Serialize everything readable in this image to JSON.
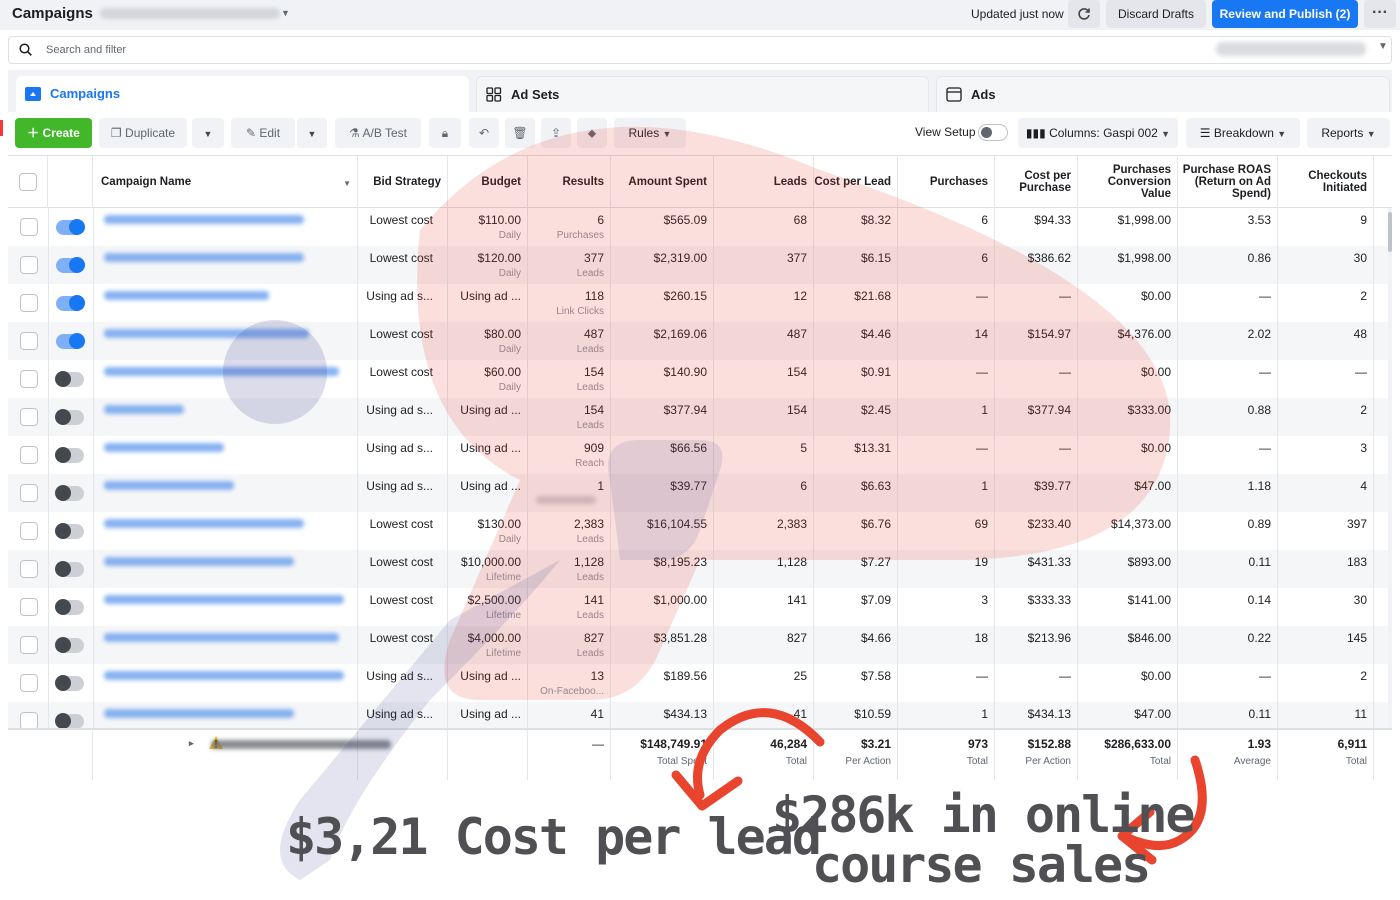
{
  "topbar": {
    "title": "Campaigns",
    "updated": "Updated just now",
    "discard": "Discard Drafts",
    "publish": "Review and Publish (2)",
    "more": "···"
  },
  "search": {
    "placeholder": "Search and filter"
  },
  "tabs": [
    {
      "label": "Campaigns",
      "icon": "folder-icon",
      "active": true
    },
    {
      "label": "Ad Sets",
      "icon": "grid-icon",
      "active": false
    },
    {
      "label": "Ads",
      "icon": "ad-icon",
      "active": false
    }
  ],
  "toolbar": {
    "create": "Create",
    "duplicate": "Duplicate",
    "edit": "Edit",
    "ab_test": "A/B Test",
    "rules": "Rules",
    "view_setup": "View Setup",
    "columns": "Columns: Gaspi 002",
    "breakdown": "Breakdown",
    "reports": "Reports"
  },
  "table": {
    "headers": {
      "campaign_name": "Campaign Name",
      "bid_strategy": "Bid Strategy",
      "budget": "Budget",
      "results": "Results",
      "amount_spent": "Amount Spent",
      "leads": "Leads",
      "cost_per_lead": "Cost per Lead",
      "purchases": "Purchases",
      "cost_per_purchase": "Cost per Purchase",
      "conversion_value": "Purchases Conversion Value",
      "roas": "Purchase ROAS (Return on Ad Spend)",
      "checkouts": "Checkouts Initiated"
    },
    "rows": [
      {
        "on": true,
        "bid": "Lowest cost",
        "budget": "$110.00",
        "budget_sub": "Daily",
        "results": "6",
        "results_sub": "Purchases",
        "spent": "$565.09",
        "leads": "68",
        "cpl": "$8.32",
        "purchases": "6",
        "cpp": "$94.33",
        "value": "$1,998.00",
        "roas": "3.53",
        "checkouts": "9"
      },
      {
        "on": true,
        "bid": "Lowest cost",
        "budget": "$120.00",
        "budget_sub": "Daily",
        "results": "377",
        "results_sub": "Leads",
        "spent": "$2,319.00",
        "leads": "377",
        "cpl": "$6.15",
        "purchases": "6",
        "cpp": "$386.62",
        "value": "$1,998.00",
        "roas": "0.86",
        "checkouts": "30"
      },
      {
        "on": true,
        "bid": "Using ad s...",
        "budget": "Using ad ...",
        "budget_sub": "",
        "results": "118",
        "results_sub": "Link Clicks",
        "spent": "$260.15",
        "leads": "12",
        "cpl": "$21.68",
        "purchases": "—",
        "cpp": "—",
        "value": "$0.00",
        "roas": "—",
        "checkouts": "2"
      },
      {
        "on": true,
        "bid": "Lowest cost",
        "budget": "$80.00",
        "budget_sub": "Daily",
        "results": "487",
        "results_sub": "Leads",
        "spent": "$2,169.06",
        "leads": "487",
        "cpl": "$4.46",
        "purchases": "14",
        "cpp": "$154.97",
        "value": "$4,376.00",
        "roas": "2.02",
        "checkouts": "48"
      },
      {
        "on": false,
        "bid": "Lowest cost",
        "budget": "$60.00",
        "budget_sub": "Daily",
        "results": "154",
        "results_sub": "Leads",
        "spent": "$140.90",
        "leads": "154",
        "cpl": "$0.91",
        "purchases": "—",
        "cpp": "—",
        "value": "$0.00",
        "roas": "—",
        "checkouts": "—"
      },
      {
        "on": false,
        "bid": "Using ad s...",
        "budget": "Using ad ...",
        "budget_sub": "",
        "results": "154",
        "results_sub": "Leads",
        "spent": "$377.94",
        "leads": "154",
        "cpl": "$2.45",
        "purchases": "1",
        "cpp": "$377.94",
        "value": "$333.00",
        "roas": "0.88",
        "checkouts": "2"
      },
      {
        "on": false,
        "bid": "Using ad s...",
        "budget": "Using ad ...",
        "budget_sub": "",
        "results": "909",
        "results_sub": "Reach",
        "spent": "$66.56",
        "leads": "5",
        "cpl": "$13.31",
        "purchases": "—",
        "cpp": "—",
        "value": "$0.00",
        "roas": "—",
        "checkouts": "3"
      },
      {
        "on": false,
        "bid": "Using ad s...",
        "budget": "Using ad ...",
        "budget_sub": "",
        "results": "1",
        "results_sub": "",
        "spent": "$39.77",
        "leads": "6",
        "cpl": "$6.63",
        "purchases": "1",
        "cpp": "$39.77",
        "value": "$47.00",
        "roas": "1.18",
        "checkouts": "4"
      },
      {
        "on": false,
        "bid": "Lowest cost",
        "budget": "$130.00",
        "budget_sub": "Daily",
        "results": "2,383",
        "results_sub": "Leads",
        "spent": "$16,104.55",
        "leads": "2,383",
        "cpl": "$6.76",
        "purchases": "69",
        "cpp": "$233.40",
        "value": "$14,373.00",
        "roas": "0.89",
        "checkouts": "397"
      },
      {
        "on": false,
        "bid": "Lowest cost",
        "budget": "$10,000.00",
        "budget_sub": "Lifetime",
        "results": "1,128",
        "results_sub": "Leads",
        "spent": "$8,195.23",
        "leads": "1,128",
        "cpl": "$7.27",
        "purchases": "19",
        "cpp": "$431.33",
        "value": "$893.00",
        "roas": "0.11",
        "checkouts": "183"
      },
      {
        "on": false,
        "bid": "Lowest cost",
        "budget": "$2,500.00",
        "budget_sub": "Lifetime",
        "results": "141",
        "results_sub": "Leads",
        "spent": "$1,000.00",
        "leads": "141",
        "cpl": "$7.09",
        "purchases": "3",
        "cpp": "$333.33",
        "value": "$141.00",
        "roas": "0.14",
        "checkouts": "30"
      },
      {
        "on": false,
        "bid": "Lowest cost",
        "budget": "$4,000.00",
        "budget_sub": "Lifetime",
        "results": "827",
        "results_sub": "Leads",
        "spent": "$3,851.28",
        "leads": "827",
        "cpl": "$4.66",
        "purchases": "18",
        "cpp": "$213.96",
        "value": "$846.00",
        "roas": "0.22",
        "checkouts": "145"
      },
      {
        "on": false,
        "bid": "Using ad s...",
        "budget": "Using ad ...",
        "budget_sub": "",
        "results": "13",
        "results_sub": "On-Faceboo...",
        "spent": "$189.56",
        "leads": "25",
        "cpl": "$7.58",
        "purchases": "—",
        "cpp": "—",
        "value": "$0.00",
        "roas": "—",
        "checkouts": "2"
      },
      {
        "on": false,
        "bid": "Using ad s...",
        "budget": "Using ad ...",
        "budget_sub": "",
        "results": "41",
        "results_sub": "",
        "spent": "$434.13",
        "leads": "41",
        "cpl": "$10.59",
        "purchases": "1",
        "cpp": "$434.13",
        "value": "$47.00",
        "roas": "0.11",
        "checkouts": "11"
      }
    ],
    "totals": {
      "results": "—",
      "spent": "$148,749.91",
      "spent_sub": "Total Spent",
      "leads": "46,284",
      "leads_sub": "Total",
      "cpl": "$3.21",
      "cpl_sub": "Per Action",
      "purchases": "973",
      "purchases_sub": "Total",
      "cpp": "$152.88",
      "cpp_sub": "Per Action",
      "value": "$286,633.00",
      "value_sub": "Total",
      "roas": "1.93",
      "roas_sub": "Average",
      "checkouts": "6,911",
      "checkouts_sub": "Total"
    }
  },
  "annotations": {
    "left": "$3,21 Cost per lead",
    "right_line1": "$286k in online",
    "right_line2": "course sales"
  },
  "colors": {
    "accent": "#1877f2",
    "create_green": "#42b72a",
    "arrow_red": "#e8442e",
    "annotation_text": "#505054"
  }
}
